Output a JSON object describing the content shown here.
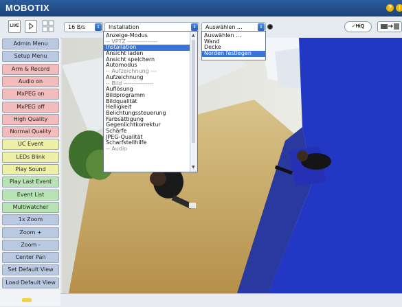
{
  "app": {
    "logo": "MOBOTIX",
    "help_icon": "help-icon"
  },
  "toolbar": {
    "live_label": "LIVE",
    "frame_rate": "16 B/s",
    "mode_select": "Installation",
    "orientation_select": "Auswählen ...",
    "hiq_label": "HiQ"
  },
  "mode_menu": {
    "items": [
      {
        "label": "Anzeige-Modus",
        "type": "item"
      },
      {
        "label": "-- VPTZ ---------------",
        "type": "sep"
      },
      {
        "label": "Installation",
        "type": "selected"
      },
      {
        "label": "Ansicht laden",
        "type": "item"
      },
      {
        "label": "Ansicht speichern",
        "type": "item"
      },
      {
        "label": "Automodus",
        "type": "item"
      },
      {
        "label": "-- Aufzeichnung ---",
        "type": "sep"
      },
      {
        "label": "Aufzeichnung",
        "type": "item"
      },
      {
        "label": "-- Bild ---------------",
        "type": "sep"
      },
      {
        "label": "Auflösung",
        "type": "item"
      },
      {
        "label": "Bildprogramm",
        "type": "item"
      },
      {
        "label": "Bildqualität",
        "type": "item"
      },
      {
        "label": "Helligkeit",
        "type": "item"
      },
      {
        "label": "Belichtungssteuerung",
        "type": "item"
      },
      {
        "label": "Farbsättigung",
        "type": "item"
      },
      {
        "label": "Gegenlichtkorrektur",
        "type": "item"
      },
      {
        "label": "Schärfe",
        "type": "item"
      },
      {
        "label": "JPEG-Qualität",
        "type": "item"
      },
      {
        "label": "Scharfstellhilfe",
        "type": "item"
      },
      {
        "label": "-- Audio",
        "type": "sep"
      }
    ]
  },
  "orientation_menu": {
    "items": [
      {
        "label": "Auswählen ...",
        "type": "item"
      },
      {
        "label": "Wand",
        "type": "item"
      },
      {
        "label": "Decke",
        "type": "item"
      },
      {
        "label": "Norden festlegen",
        "type": "selected"
      }
    ]
  },
  "sidebar": {
    "buttons": [
      {
        "label": "Admin Menu",
        "color": "#b9c9e2"
      },
      {
        "label": "Setup Menu",
        "color": "#b9c9e2"
      },
      {
        "label": "Arm & Record",
        "color": "#f2bcbc"
      },
      {
        "label": "Audio on",
        "color": "#f2bcbc"
      },
      {
        "label": "MxPEG on",
        "color": "#f2bcbc"
      },
      {
        "label": "MxPEG off",
        "color": "#f2bcbc"
      },
      {
        "label": "High Quality",
        "color": "#f2bcbc"
      },
      {
        "label": "Normal Quality",
        "color": "#f2bcbc"
      },
      {
        "label": "UC Event",
        "color": "#eef0a8"
      },
      {
        "label": "LEDs Blink",
        "color": "#eef0a8"
      },
      {
        "label": "Play Sound",
        "color": "#eef0a8"
      },
      {
        "label": "Play Last Event",
        "color": "#b8e3b4"
      },
      {
        "label": "Event List",
        "color": "#b8e3b4"
      },
      {
        "label": "Multiwatcher",
        "color": "#b8e3b4"
      },
      {
        "label": "1x Zoom",
        "color": "#b9c9e2"
      },
      {
        "label": "Zoom +",
        "color": "#b9c9e2"
      },
      {
        "label": "Zoom -",
        "color": "#b9c9e2"
      },
      {
        "label": "Center Pan",
        "color": "#b9c9e2"
      },
      {
        "label": "Set Default View",
        "color": "#b9c9e2"
      },
      {
        "label": "Load Default View",
        "color": "#b9c9e2"
      }
    ]
  }
}
